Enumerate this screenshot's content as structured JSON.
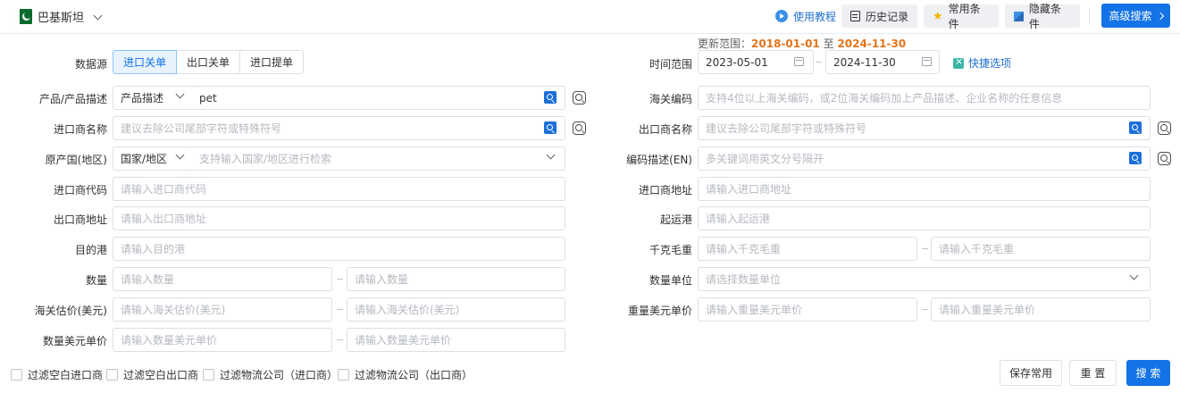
{
  "header": {
    "country": "巴基斯坦",
    "tutorial": "使用教程",
    "history": "历史记录",
    "common": "常用条件",
    "hidden": "隐藏条件",
    "advanced_search": "高级搜索"
  },
  "update_range": {
    "prefix": "更新范围：",
    "start": "2018-01-01",
    "sep": "至",
    "end": "2024-11-30"
  },
  "left": {
    "datasource": {
      "label": "数据源",
      "options": [
        "进口关单",
        "出口关单",
        "进口提单"
      ],
      "active": 0
    },
    "product": {
      "label": "产品/产品描述",
      "select": "产品描述",
      "value": "pet"
    },
    "importer_name": {
      "label": "进口商名称",
      "placeholder": "建议去除公司尾部字符或特殊符号"
    },
    "origin": {
      "label": "原产国(地区)",
      "select": "国家/地区",
      "placeholder": "支持输入国家/地区进行检索"
    },
    "importer_code": {
      "label": "进口商代码",
      "placeholder": "请输入进口商代码"
    },
    "exporter_address": {
      "label": "出口商地址",
      "placeholder": "请输入出口商地址"
    },
    "dest_port": {
      "label": "目的港",
      "placeholder": "请输入目的港"
    },
    "quantity": {
      "label": "数量",
      "placeholder_from": "请输入数量",
      "placeholder_to": "请输入数量"
    },
    "customs_value": {
      "label": "海关估价(美元)",
      "placeholder_from": "请输入海关估价(美元)",
      "placeholder_to": "请输入海关估价(美元)"
    },
    "qty_unit_price": {
      "label": "数量美元单价",
      "placeholder_from": "请输入数量美元单价",
      "placeholder_to": "请输入数量美元单价"
    }
  },
  "right": {
    "time_range": {
      "label": "时间范围",
      "start": "2023-05-01",
      "end": "2024-11-30",
      "quick": "快捷选项"
    },
    "hs_code": {
      "label": "海关编码",
      "placeholder": "支持4位以上海关编码，或2位海关编码加上产品描述、企业名称的任意信息"
    },
    "exporter_name": {
      "label": "出口商名称",
      "placeholder": "建议去除公司尾部字符或特殊符号"
    },
    "code_desc": {
      "label": "编码描述(EN)",
      "placeholder": "多关键词用英文分号隔开"
    },
    "importer_address": {
      "label": "进口商地址",
      "placeholder": "请输入进口商地址"
    },
    "origin_port": {
      "label": "起运港",
      "placeholder": "请输入起运港"
    },
    "gross_weight": {
      "label": "千克毛重",
      "placeholder_from": "请输入千克毛重",
      "placeholder_to": "请输入千克毛重"
    },
    "qty_unit": {
      "label": "数量单位",
      "placeholder": "请选择数量单位"
    },
    "weight_unit_price": {
      "label": "重量美元单价",
      "placeholder_from": "请输入重量美元单价",
      "placeholder_to": "请输入重量美元单价"
    }
  },
  "filters": [
    "过滤空白进口商",
    "过滤空白出口商",
    "过滤物流公司（进口商）",
    "过滤物流公司（出口商）"
  ],
  "actions": {
    "save_common": "保存常用",
    "reset": "重 置",
    "search": "搜 索"
  }
}
